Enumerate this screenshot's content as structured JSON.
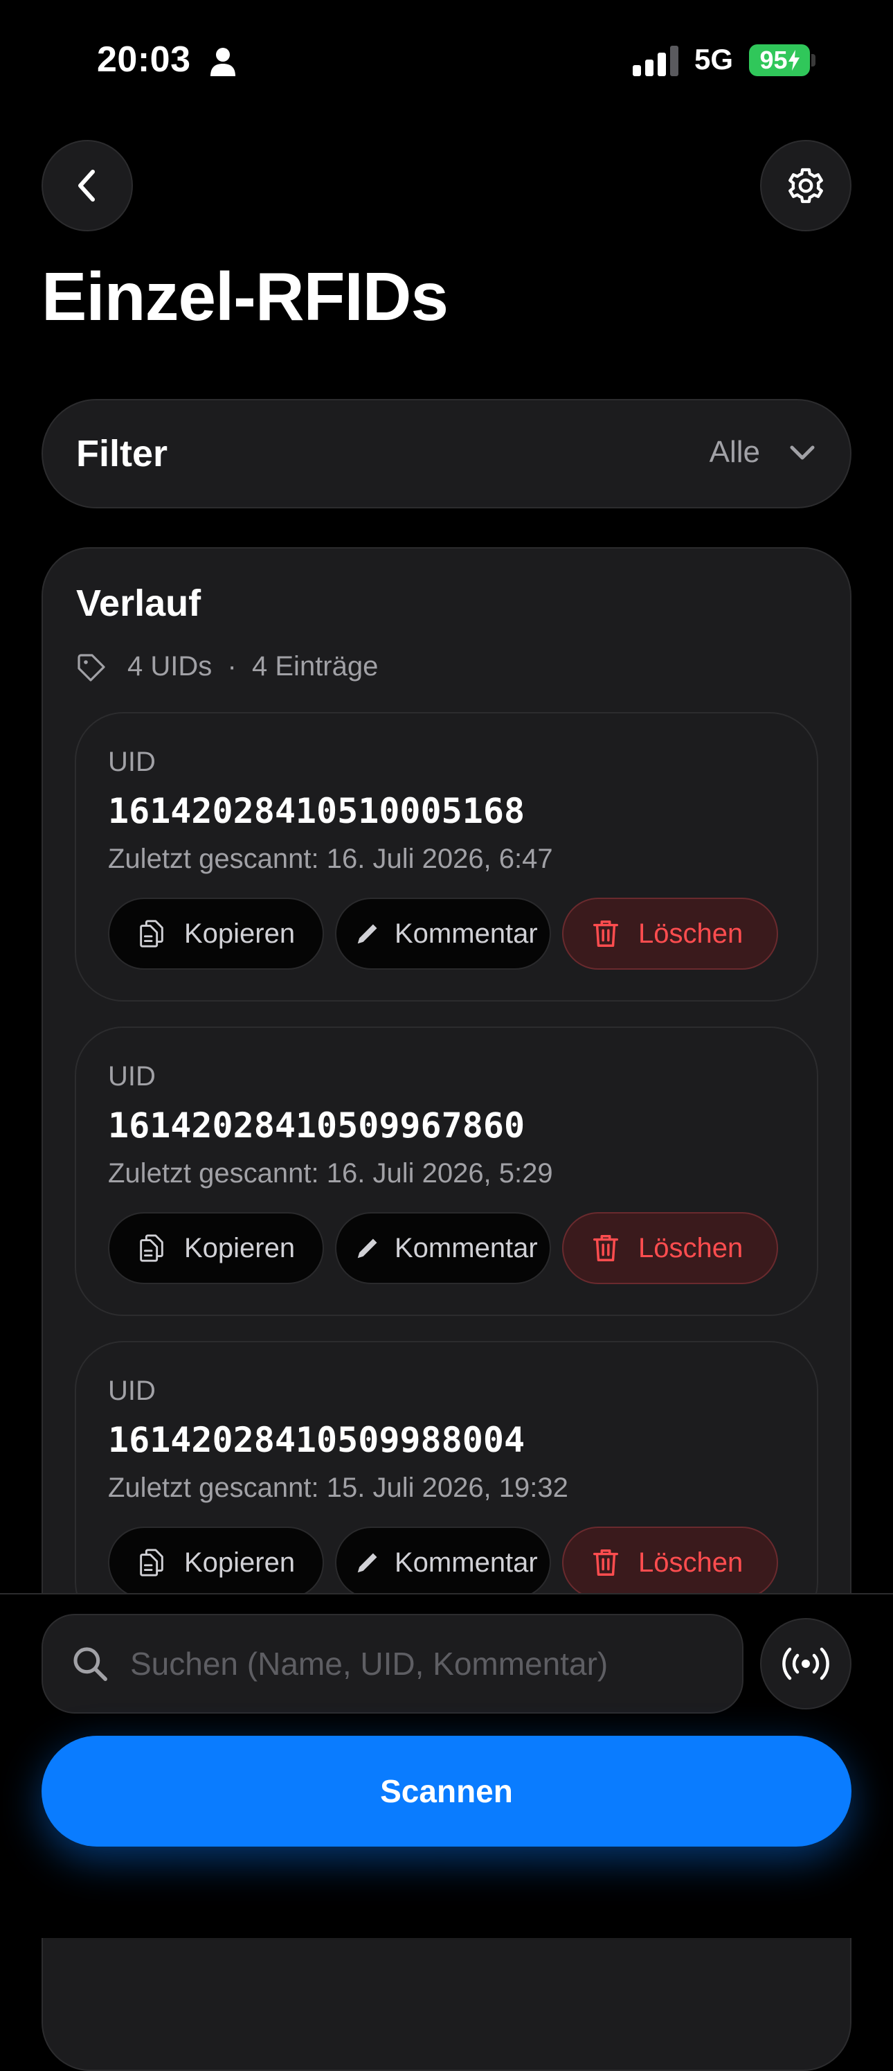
{
  "status_bar": {
    "time": "20:03",
    "network": "5G",
    "battery": "95"
  },
  "header": {
    "title": "Einzel-RFIDs"
  },
  "filter": {
    "label": "Filter",
    "value": "Alle"
  },
  "history": {
    "title": "Verlauf",
    "meta": "4 UIDs  ·  4 Einträge",
    "entries": [
      {
        "uid_label": "UID",
        "uid": "16142028410510005168",
        "scanned": "Zuletzt gescannt: 16. Juli 2026, 6:47",
        "copy_label": "Kopieren",
        "comment_label": "Kommentar",
        "delete_label": "Löschen"
      },
      {
        "uid_label": "UID",
        "uid": "16142028410509967860",
        "scanned": "Zuletzt gescannt: 16. Juli 2026, 5:29",
        "copy_label": "Kopieren",
        "comment_label": "Kommentar",
        "delete_label": "Löschen"
      },
      {
        "uid_label": "UID",
        "uid": "16142028410509988004",
        "scanned": "Zuletzt gescannt: 15. Juli 2026, 19:32",
        "copy_label": "Kopieren",
        "comment_label": "Kommentar",
        "delete_label": "Löschen"
      }
    ]
  },
  "search": {
    "placeholder": "Suchen (Name, UID, Kommentar)",
    "value": ""
  },
  "scan_button": {
    "label": "Scannen"
  },
  "colors": {
    "accent": "#0a7cff",
    "danger": "#ff4d4f",
    "battery": "#30c75a",
    "background": "#000000",
    "surface": "#1c1c1e"
  }
}
